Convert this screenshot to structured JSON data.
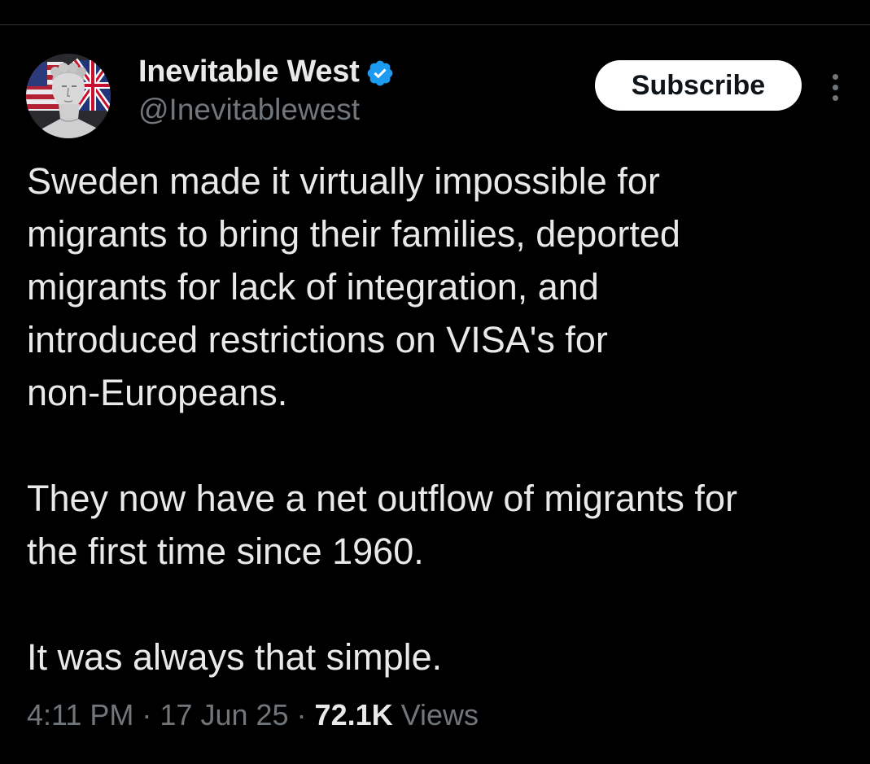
{
  "author": {
    "display_name": "Inevitable West",
    "handle": "@Inevitablewest",
    "verified": true,
    "avatar_icon": "statue-flag-avatar-icon"
  },
  "actions": {
    "subscribe_label": "Subscribe",
    "more_icon": "more-vertical-icon"
  },
  "tweet": {
    "paragraphs": [
      [
        "Sweden made it virtually impossible for",
        "migrants to bring their families, deported",
        "migrants for lack of integration, and",
        "introduced restrictions on VISA's for",
        "non-Europeans."
      ],
      [
        "They now have a net outflow of migrants for",
        "the first time since 1960."
      ],
      [
        "It was always that simple."
      ]
    ]
  },
  "meta": {
    "time": "4:11 PM",
    "date": "17 Jun 25",
    "separator": "·",
    "views_count": "72.1K",
    "views_label": "Views"
  },
  "colors": {
    "background": "#000000",
    "text_primary": "#e7e9ea",
    "text_secondary": "#71767b",
    "verified_blue": "#1d9bf0",
    "button_bg": "#ffffff",
    "button_text": "#0f1419"
  }
}
